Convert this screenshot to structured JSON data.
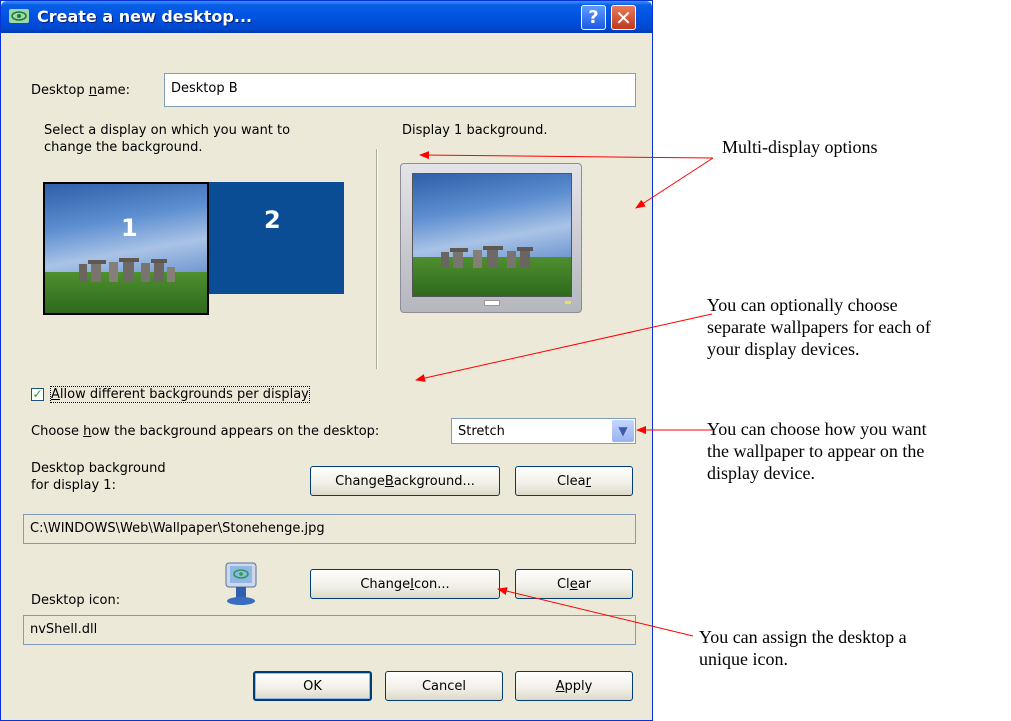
{
  "window": {
    "title": "Create a new desktop...",
    "help_glyph": "?",
    "close_glyph": "✕"
  },
  "desktop_name": {
    "label_pre": "Desktop ",
    "label_u": "n",
    "label_post": "ame:",
    "value": "Desktop B"
  },
  "select_display": {
    "line1": "Select a display on which you want to",
    "line2": "change the background."
  },
  "monitors": [
    {
      "number": "1"
    },
    {
      "number": "2"
    }
  ],
  "preview": {
    "caption": "Display 1 background."
  },
  "allow_different": {
    "checked": true,
    "label_u": "A",
    "label_rest": "llow different backgrounds per display"
  },
  "appearance": {
    "label_pre": "Choose ",
    "label_u": "h",
    "label_post": "ow the background appears on the desktop:",
    "selected": "Stretch"
  },
  "background": {
    "line1": "Desktop background",
    "line2": "for display 1:",
    "change_pre": "Change ",
    "change_u": "B",
    "change_post": "ackground...",
    "clear_pre": "Clea",
    "clear_u": "r",
    "path": "C:\\WINDOWS\\Web\\Wallpaper\\Stonehenge.jpg"
  },
  "icon": {
    "label": "Desktop icon:",
    "change_pre": "Change ",
    "change_u": "I",
    "change_post": "con...",
    "clear_pre": "Cl",
    "clear_u": "e",
    "clear_post": "ar",
    "file": "nvShell.dll"
  },
  "footer": {
    "ok": "OK",
    "cancel": "Cancel",
    "apply_u": "A",
    "apply_rest": "pply"
  },
  "annotations": {
    "multi_display": "Multi-display options",
    "wallpapers": [
      "You can optionally choose",
      "separate wallpapers for each of",
      "your display devices."
    ],
    "howto": [
      "You can choose how you want",
      "the wallpaper to appear on the",
      "display device."
    ],
    "icon_note": [
      "You can assign the desktop a",
      "unique icon."
    ]
  },
  "colors": {
    "arrow": "#ff0000",
    "titlebar": "#0054e3",
    "dialog": "#ece9d8"
  }
}
